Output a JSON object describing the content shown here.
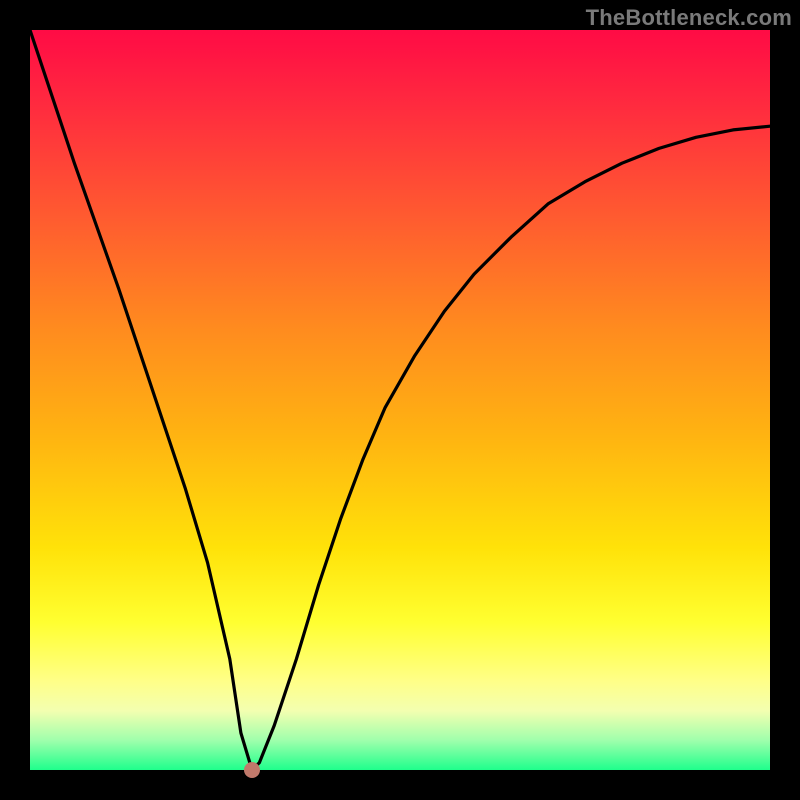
{
  "watermark": "TheBottleneck.com",
  "chart_data": {
    "type": "line",
    "title": "",
    "xlabel": "",
    "ylabel": "",
    "xlim": [
      0,
      100
    ],
    "ylim": [
      0,
      100
    ],
    "notes": "Background gradient encodes score: top=red (bad) → bottom=green (good). Curve is a V-shaped profile with minimum at x≈30.",
    "series": [
      {
        "name": "bottleneck-curve",
        "x": [
          0,
          3,
          6,
          9,
          12,
          15,
          18,
          21,
          24,
          27,
          28.5,
          30,
          31,
          33,
          36,
          39,
          42,
          45,
          48,
          52,
          56,
          60,
          65,
          70,
          75,
          80,
          85,
          90,
          95,
          100
        ],
        "values": [
          100,
          91,
          82,
          73.5,
          65,
          56,
          47,
          38,
          28,
          15,
          5,
          0,
          1,
          6,
          15,
          25,
          34,
          42,
          49,
          56,
          62,
          67,
          72,
          76.5,
          79.5,
          82,
          84,
          85.5,
          86.5,
          87
        ]
      }
    ],
    "marker": {
      "x": 30,
      "y": 0,
      "color": "#c1796b",
      "radius_px": 8
    }
  },
  "colors": {
    "frame": "#000000",
    "curve": "#000000",
    "marker": "#c1796b",
    "gradient_stops": [
      "#ff0b45",
      "#ff8a1f",
      "#ffe209",
      "#ffff88",
      "#1fff8c"
    ]
  }
}
